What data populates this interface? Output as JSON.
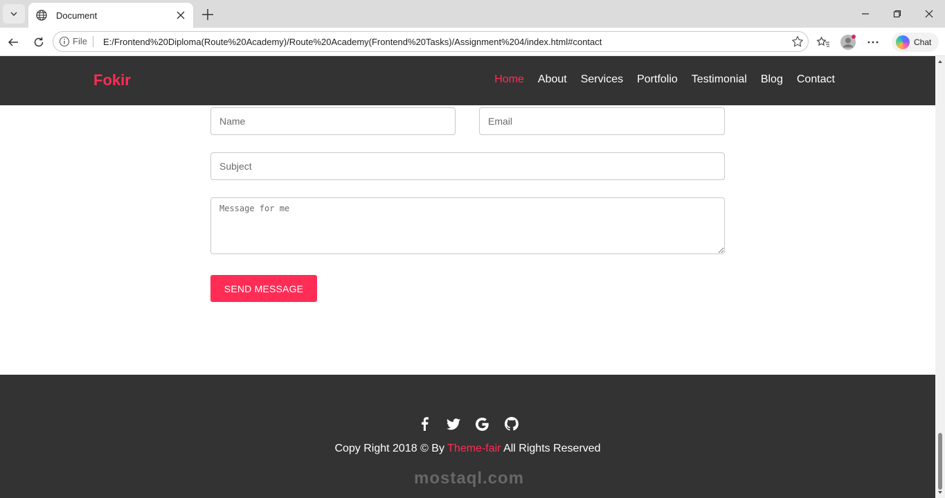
{
  "browser": {
    "tab_title": "Document",
    "address_protocol": "File",
    "address_url": "E:/Frontend%20Diploma(Route%20Academy)/Route%20Academy(Frontend%20Tasks)/Assignment%204/index.html#contact",
    "copilot_label": "Chat"
  },
  "navbar": {
    "brand": "Fokir",
    "links": [
      "Home",
      "About",
      "Services",
      "Portfolio",
      "Testimonial",
      "Blog",
      "Contact"
    ],
    "active_index": 0
  },
  "form": {
    "name_placeholder": "Name",
    "email_placeholder": "Email",
    "subject_placeholder": "Subject",
    "message_placeholder": "Message for me",
    "submit_label": "SEND MESSAGE"
  },
  "footer": {
    "social_icons": [
      "facebook-icon",
      "twitter-icon",
      "google-icon",
      "github-icon"
    ],
    "copy_prefix": "Copy Right 2018 © By",
    "copy_highlight": "Theme-fair",
    "copy_suffix": "All Rights Reserved",
    "watermark": "mostaql.com"
  },
  "colors": {
    "accent": "#ff2d55",
    "dark": "#333333"
  }
}
